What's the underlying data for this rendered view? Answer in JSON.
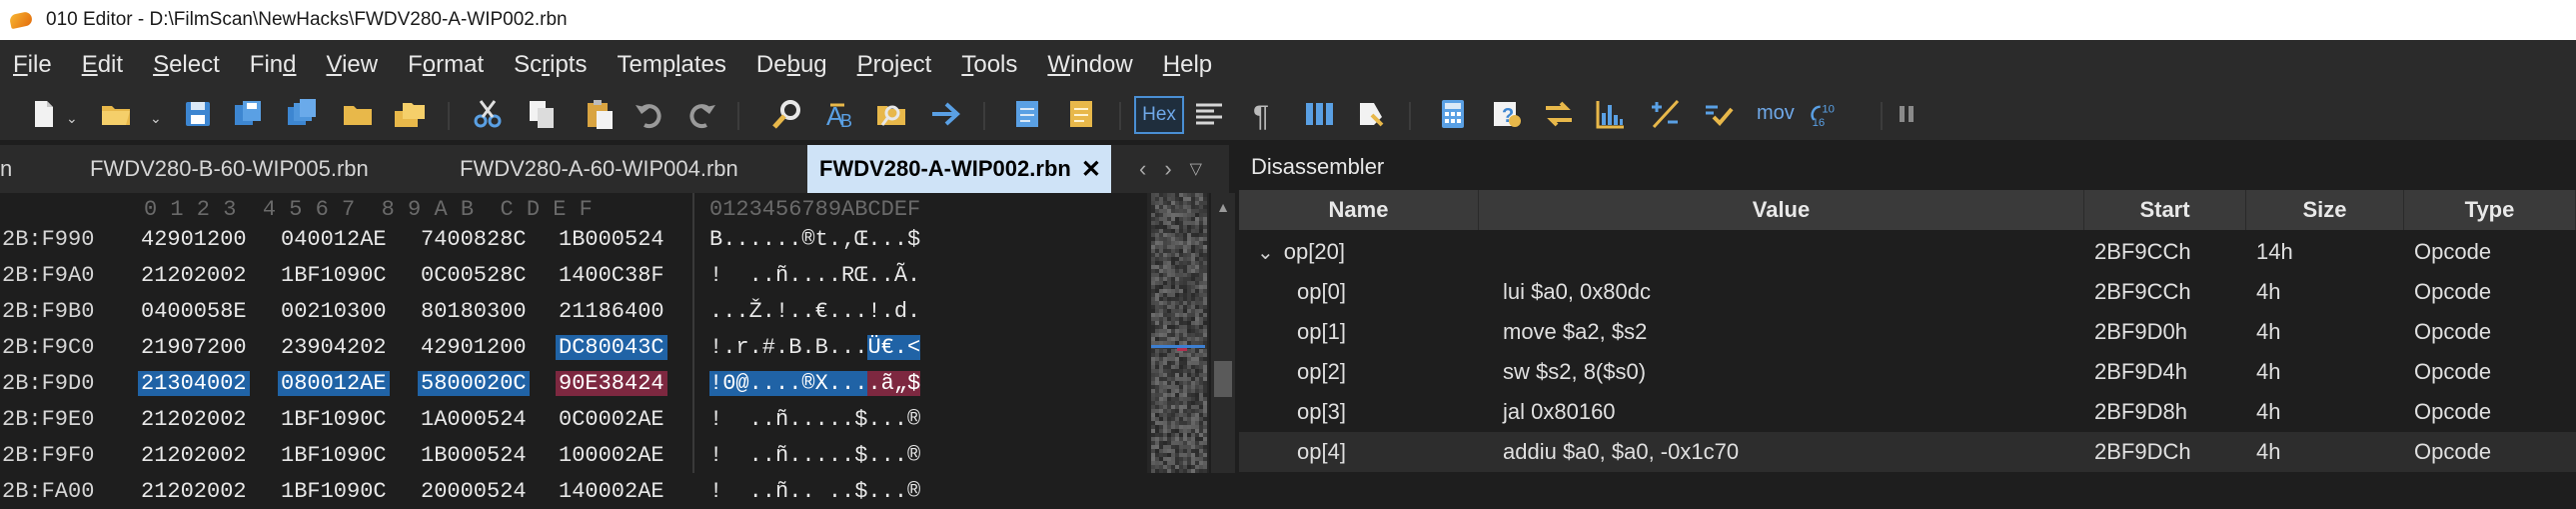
{
  "window": {
    "app_name": "010 Editor",
    "title": "010 Editor - D:\\FilmScan\\NewHacks\\FWDV280-A-WIP002.rbn"
  },
  "menu": [
    {
      "label": "File",
      "ul": "F",
      "rest": "ile"
    },
    {
      "label": "Edit",
      "ul": "E",
      "rest": "dit"
    },
    {
      "label": "Select",
      "ul": "S",
      "rest": "elect"
    },
    {
      "label": "Find",
      "pre": "Fin",
      "ul": "d",
      "rest": ""
    },
    {
      "label": "View",
      "ul": "V",
      "rest": "iew"
    },
    {
      "label": "Format",
      "pre": "F",
      "ul": "o",
      "rest": "rmat"
    },
    {
      "label": "Scripts",
      "pre": "Sc",
      "ul": "r",
      "rest": "ipts"
    },
    {
      "label": "Templates",
      "pre": "Temp",
      "ul": "l",
      "rest": "ates"
    },
    {
      "label": "Debug",
      "pre": "De",
      "ul": "b",
      "rest": "ug"
    },
    {
      "label": "Project",
      "ul": "P",
      "rest": "roject"
    },
    {
      "label": "Tools",
      "ul": "T",
      "rest": "ools"
    },
    {
      "label": "Window",
      "ul": "W",
      "rest": "indow"
    },
    {
      "label": "Help",
      "ul": "H",
      "rest": "elp"
    }
  ],
  "toolbar": {
    "hex_label": "Hex",
    "mov_label": "mov",
    "base_label": "10\n16"
  },
  "tabs": {
    "clipped": "n",
    "items": [
      "FWDV280-B-60-WIP005.rbn",
      "FWDV280-A-60-WIP004.rbn",
      "FWDV280-A-WIP002.rbn"
    ],
    "active_index": 2,
    "close_glyph": "✕"
  },
  "hex": {
    "header_hex": "0 1 2 3  4 5 6 7  8 9 A B  C D E F",
    "header_ascii": "0123456789ABCDEF",
    "rows": [
      {
        "addr": "2B:F990",
        "words": [
          "42901200",
          "040012AE",
          "7400828C",
          "1B000524"
        ],
        "ascii": "B......®t.‚Œ...$",
        "sel": [
          "",
          "",
          "",
          ""
        ]
      },
      {
        "addr": "2B:F9A0",
        "words": [
          "21202002",
          "1BF1090C",
          "0C00528C",
          "1400C38F"
        ],
        "ascii": "!  ..ñ....RŒ..Ã.",
        "sel": [
          "",
          "",
          "",
          ""
        ]
      },
      {
        "addr": "2B:F9B0",
        "words": [
          "0400058E",
          "00210300",
          "80180300",
          "21186400"
        ],
        "ascii": "...Ž.!..€...!.d.",
        "sel": [
          "",
          "",
          "",
          ""
        ]
      },
      {
        "addr": "2B:F9C0",
        "words": [
          "21907200",
          "23904202",
          "42901200",
          "DC80043C"
        ],
        "ascii_parts": [
          {
            "t": "!.r.#.B.B...",
            "c": ""
          },
          {
            "t": "Ü€.<",
            "c": "sel-blue"
          }
        ],
        "sel": [
          "",
          "",
          "",
          "sel-blue"
        ]
      },
      {
        "addr": "2B:F9D0",
        "words": [
          "21304002",
          "080012AE",
          "5800020C",
          "90E38424"
        ],
        "ascii_parts": [
          {
            "t": "!0@....®X...",
            "c": "sel-blue"
          },
          {
            "t": ".ã„$",
            "c": "sel-red"
          }
        ],
        "sel": [
          "sel-blue",
          "sel-blue",
          "sel-blue",
          "sel-red"
        ]
      },
      {
        "addr": "2B:F9E0",
        "words": [
          "21202002",
          "1BF1090C",
          "1A000524",
          "0C0002AE"
        ],
        "ascii": "!  ..ñ.....$...®",
        "sel": [
          "",
          "",
          "",
          ""
        ]
      },
      {
        "addr": "2B:F9F0",
        "words": [
          "21202002",
          "1BF1090C",
          "1B000524",
          "100002AE"
        ],
        "ascii": "!  ..ñ.....$...®",
        "sel": [
          "",
          "",
          "",
          ""
        ]
      },
      {
        "addr": "2B:FA00",
        "words": [
          "21202002",
          "1BF1090C",
          "20000524",
          "140002AE"
        ],
        "ascii": "!  ..ñ.. ..$...®",
        "sel": [
          "",
          "",
          "",
          ""
        ]
      }
    ]
  },
  "disassembler": {
    "title": "Disassembler",
    "columns": [
      "Name",
      "Value",
      "Start",
      "Size",
      "Type"
    ],
    "rows": [
      {
        "name": "op[20]",
        "value": "",
        "start": "2BF9CCh",
        "size": "14h",
        "type": "Opcode",
        "expand": "⌄",
        "indent": 0
      },
      {
        "name": "op[0]",
        "value": "lui $a0, 0x80dc",
        "start": "2BF9CCh",
        "size": "4h",
        "type": "Opcode",
        "indent": 1
      },
      {
        "name": "op[1]",
        "value": "move $a2, $s2",
        "start": "2BF9D0h",
        "size": "4h",
        "type": "Opcode",
        "indent": 1
      },
      {
        "name": "op[2]",
        "value": "sw $s2, 8($s0)",
        "start": "2BF9D4h",
        "size": "4h",
        "type": "Opcode",
        "indent": 1
      },
      {
        "name": "op[3]",
        "value": "jal 0x80160",
        "start": "2BF9D8h",
        "size": "4h",
        "type": "Opcode",
        "indent": 1
      },
      {
        "name": "op[4]",
        "value": "addiu $a0, $a0, -0x1c70",
        "start": "2BF9DCh",
        "size": "4h",
        "type": "Opcode",
        "indent": 1,
        "highlight": true
      }
    ]
  },
  "colors": {
    "accent": "#2063a6",
    "selection_red": "#7d2840",
    "tab_active": "#cfe3f7"
  }
}
